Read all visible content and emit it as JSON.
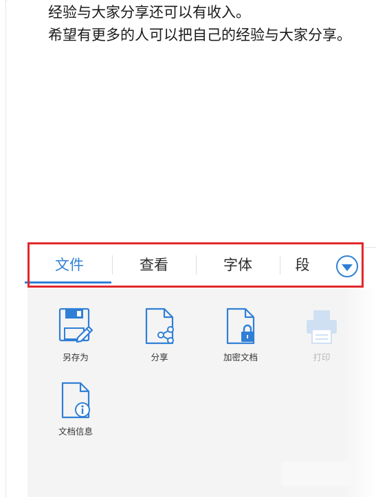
{
  "document": {
    "lines": [
      "经验与大家分享还可以有收入。",
      "希望有更多的人可以把自己的经验与大家分享。"
    ]
  },
  "tabs": [
    {
      "label": "文件",
      "active": true
    },
    {
      "label": "查看",
      "active": false
    },
    {
      "label": "字体",
      "active": false
    },
    {
      "label": "段",
      "active": false
    }
  ],
  "actions": [
    {
      "label": "另存为",
      "icon": "save-as-icon",
      "enabled": true
    },
    {
      "label": "分享",
      "icon": "share-icon",
      "enabled": true
    },
    {
      "label": "加密文档",
      "icon": "lock-document-icon",
      "enabled": true
    },
    {
      "label": "打印",
      "icon": "printer-icon",
      "enabled": false
    },
    {
      "label": "文档信息",
      "icon": "document-info-icon",
      "enabled": true
    }
  ],
  "colors": {
    "accent": "#2f7fd6",
    "highlight": "#e2262a",
    "disabled": "#b8b8b8"
  }
}
